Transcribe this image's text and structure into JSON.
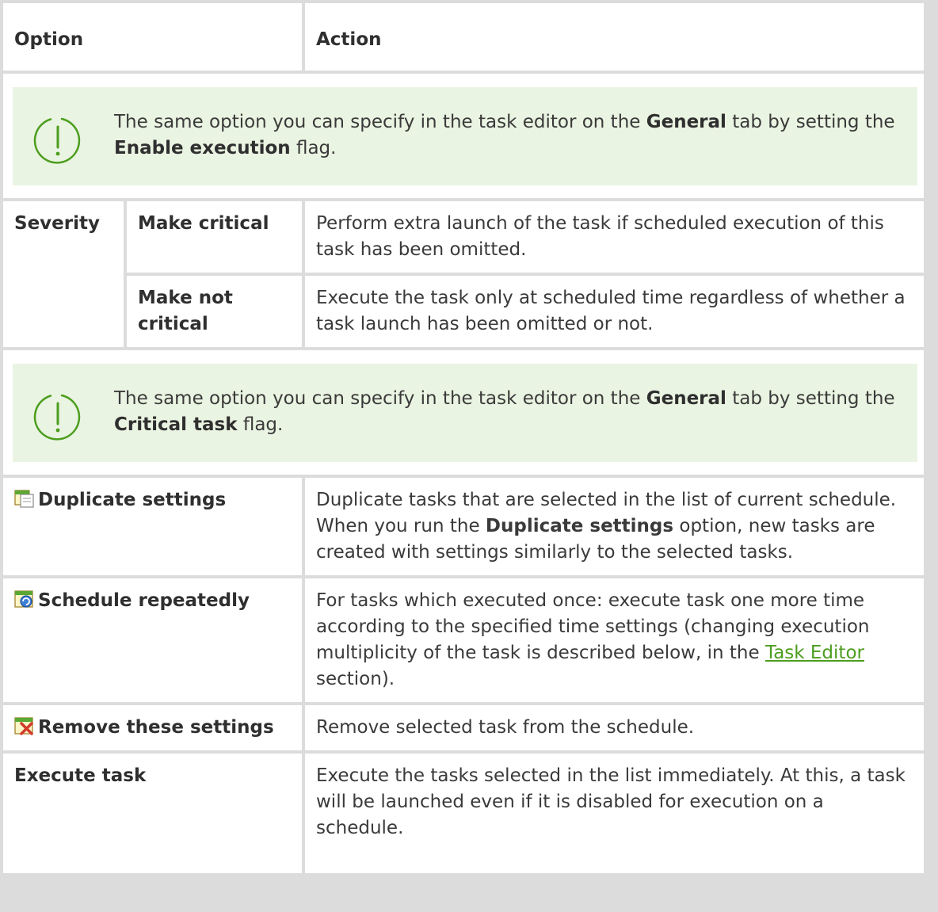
{
  "header": {
    "option": "Option",
    "action": "Action"
  },
  "note1": {
    "pre": "The same option you can specify in the task editor on the ",
    "b1": "General",
    "mid": " tab by setting the ",
    "b2": "Enable execution",
    "post": " flag."
  },
  "severity": {
    "label": "Severity",
    "critical": {
      "label": "Make critical",
      "desc": "Perform extra launch of the task if scheduled execution of this task has been omitted."
    },
    "not_critical": {
      "label": "Make not critical",
      "desc": "Execute the task only at scheduled time regardless of whether a task launch has been omitted or not."
    }
  },
  "note2": {
    "pre": "The same option you can specify in the task editor on the ",
    "b1": "General",
    "mid": " tab by setting the ",
    "b2": "Critical task",
    "post": " flag."
  },
  "duplicate": {
    "icon": "calendar-copy-icon",
    "label": "Duplicate settings",
    "desc_pre": "Duplicate tasks that are selected in the list of current schedule. When you run the ",
    "desc_b": "Duplicate settings",
    "desc_post": " option, new tasks are created with settings similarly to the selected tasks."
  },
  "repeat": {
    "icon": "calendar-repeat-icon",
    "label": "Schedule repeatedly",
    "desc_pre": "For tasks which executed once: execute task one more time according to the specified time settings (changing execution multiplicity of the task is described below, in the ",
    "link": "Task Editor",
    "desc_post": " section)."
  },
  "remove": {
    "icon": "calendar-remove-icon",
    "label": "Remove these settings",
    "desc": "Remove selected task from the schedule."
  },
  "execute": {
    "label": "Execute task",
    "desc": "Execute the tasks selected in the list immediately. At this, a task will be launched even if it is disabled for execution on a schedule."
  },
  "colors": {
    "note_bg": "#eaf4e2",
    "accent": "#4c9e1e",
    "grid": "#dcdcdc"
  }
}
